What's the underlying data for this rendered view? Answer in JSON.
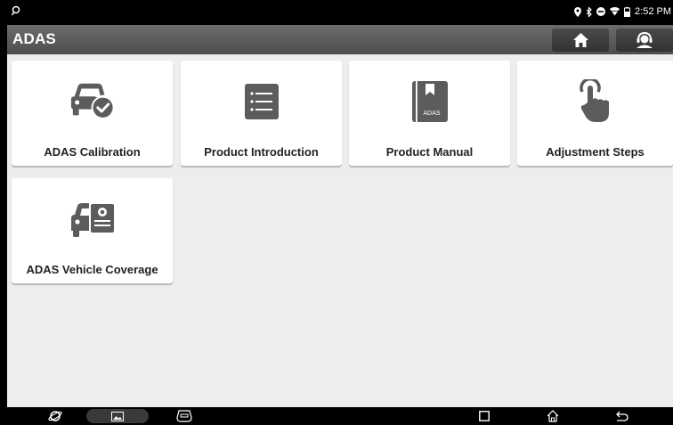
{
  "status_bar": {
    "time": "2:52 PM"
  },
  "app_bar": {
    "title": "ADAS"
  },
  "tiles": [
    {
      "label": "ADAS Calibration",
      "icon": "car-check-icon"
    },
    {
      "label": "Product Introduction",
      "icon": "list-document-icon"
    },
    {
      "label": "Product Manual",
      "icon": "manual-book-icon"
    },
    {
      "label": "Adjustment Steps",
      "icon": "touch-hand-icon"
    },
    {
      "label": "ADAS Vehicle Coverage",
      "icon": "vehicle-coverage-icon"
    }
  ],
  "book_icon_text": "ADAS",
  "colors": {
    "icon_gray": "#5c5c5c",
    "background": "#ededed",
    "app_bar": "#5a5a5a"
  }
}
